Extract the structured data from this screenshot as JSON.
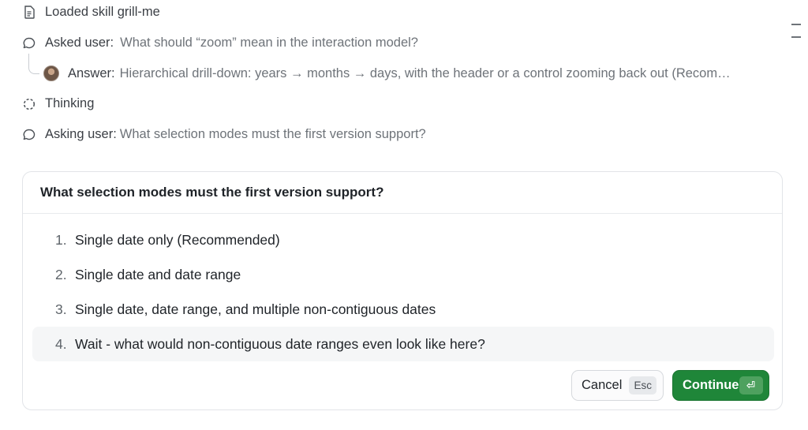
{
  "log": {
    "skill": {
      "text": "Loaded skill grill-me",
      "icon": "document-icon"
    },
    "asked": {
      "label": "Asked user:",
      "value": "What should “zoom” mean in the interaction model?",
      "icon": "chat-bubble-icon"
    },
    "answer": {
      "label": "Answer:",
      "value": "Hierarchical drill-down: years → months → days, with the header or a control zooming back out (Recom…",
      "icon": "user-avatar"
    },
    "thinking": {
      "label": "Thinking",
      "icon": "dotted-circle-icon"
    },
    "asking": {
      "label": "Asking user:",
      "value": "What selection modes must the first version support?",
      "icon": "chat-bubble-icon"
    }
  },
  "question": {
    "title": "What selection modes must the first version support?",
    "options": [
      {
        "num": "1.",
        "label": "Single date only (Recommended)"
      },
      {
        "num": "2.",
        "label": "Single date and date range"
      },
      {
        "num": "3.",
        "label": "Single date, date range, and multiple non-contiguous dates"
      },
      {
        "num": "4.",
        "label": "Wait - what would non-contiguous date ranges even look like here?"
      }
    ],
    "selected_index": 4,
    "cancel": {
      "label": "Cancel",
      "key": "Esc"
    },
    "continue": {
      "label": "Continue",
      "key": "⏎"
    }
  },
  "colors": {
    "accent": "#1f8639",
    "muted_text": "#6e7379",
    "selected_bg": "#f5f6f7"
  }
}
